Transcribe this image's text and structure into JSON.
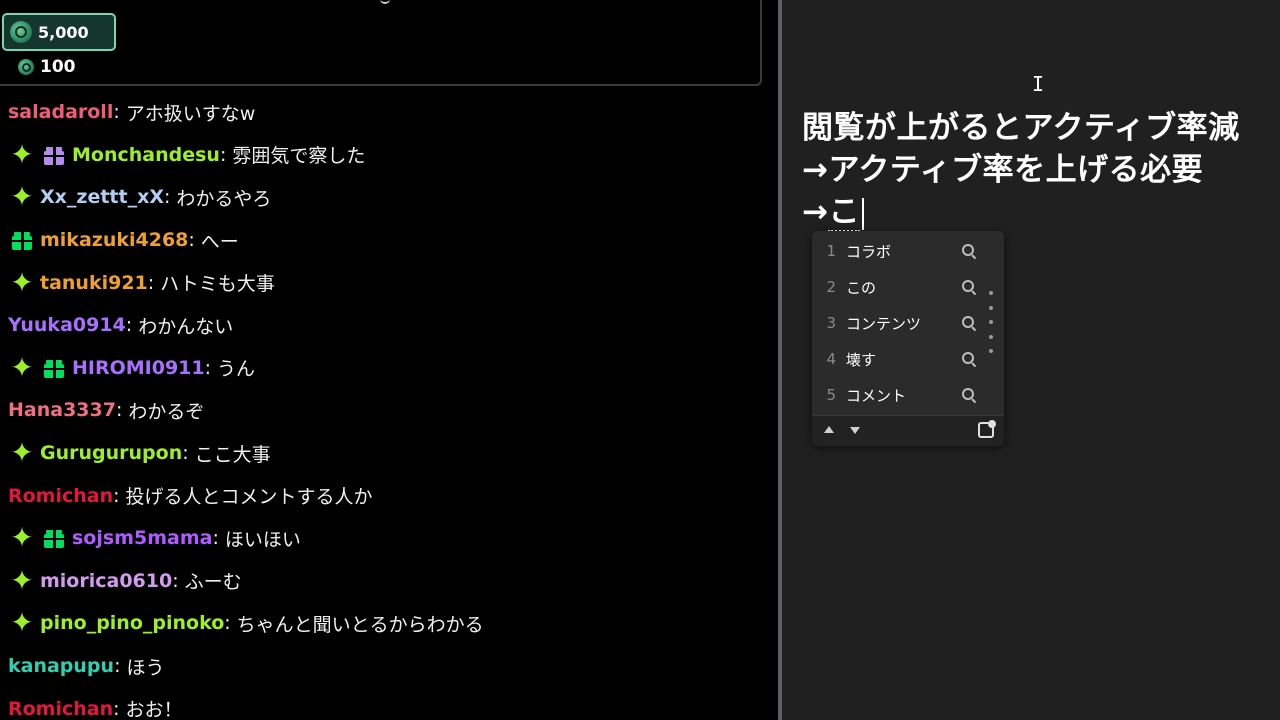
{
  "points_badge": {
    "value": "5,000",
    "icon": "channel-points-icon"
  },
  "pinned": {
    "small_points_value": "100",
    "icon": "channel-points-icon"
  },
  "chat": {
    "messages": [
      {
        "user": "saladaroll",
        "color": "#f05c7a",
        "badges": [],
        "text": "アホ扱いすなw"
      },
      {
        "user": "Monchandesu",
        "color": "#9bf02b",
        "badges": [
          "sparkle-badge-icon",
          "gift-badge-purple-icon"
        ],
        "text": "雰囲気で察した"
      },
      {
        "user": "Xx_zettt_xX",
        "color": "#b2cef2",
        "badges": [
          "sparkle-badge-icon"
        ],
        "text": "わかるやろ"
      },
      {
        "user": "mikazuki4268",
        "color": "#f0a030",
        "badges": [
          "gift-badge-green-icon"
        ],
        "text": "へー"
      },
      {
        "user": "tanuki921",
        "color": "#f0a030",
        "badges": [
          "sparkle-badge-icon"
        ],
        "text": "ハトミも大事"
      },
      {
        "user": "Yuuka0914",
        "color": "#a970ff",
        "badges": [],
        "text": "わかんない"
      },
      {
        "user": "HIROMI0911",
        "color": "#a970ff",
        "badges": [
          "sparkle-badge-icon",
          "gift-badge-green-icon"
        ],
        "text": "うん"
      },
      {
        "user": "Hana3337",
        "color": "#f07080",
        "badges": [],
        "text": "わかるぞ"
      },
      {
        "user": "Gurugurupon",
        "color": "#9bf02b",
        "badges": [
          "sparkle-badge-icon"
        ],
        "text": "ここ大事"
      },
      {
        "user": "Romichan",
        "color": "#e0183c",
        "badges": [],
        "text": "投げる人とコメントする人か"
      },
      {
        "user": "sojsm5mama",
        "color": "#b05bff",
        "badges": [
          "sparkle-badge-icon",
          "gift-badge-green-icon"
        ],
        "text": "ほいほい"
      },
      {
        "user": "miorica0610",
        "color": "#d39bf0",
        "badges": [
          "sparkle-badge-icon"
        ],
        "text": "ふーむ"
      },
      {
        "user": "pino_pino_pinoko",
        "color": "#9bf02b",
        "badges": [
          "sparkle-badge-icon"
        ],
        "text": "ちゃんと聞いとるからわかる"
      },
      {
        "user": "kanapupu",
        "color": "#2fd0b0",
        "badges": [],
        "text": "ほう"
      },
      {
        "user": "Romichan",
        "color": "#e0183c",
        "badges": [],
        "text": "おお！"
      }
    ]
  },
  "notes": {
    "line1": "閲覧が上がるとアクティブ率減",
    "line2": "→アクティブ率を上げる必要",
    "line3_prefix": "→",
    "line3_composing": "こ"
  },
  "ime": {
    "candidates": [
      {
        "num": "1",
        "word": "コラボ"
      },
      {
        "num": "2",
        "word": "この"
      },
      {
        "num": "3",
        "word": "コンテンツ"
      },
      {
        "num": "4",
        "word": "壊す"
      },
      {
        "num": "5",
        "word": "コメント"
      }
    ],
    "icons": {
      "search": "search-icon",
      "prev": "page-up-icon",
      "next": "page-down-icon",
      "expand": "expand-candidates-icon"
    }
  }
}
